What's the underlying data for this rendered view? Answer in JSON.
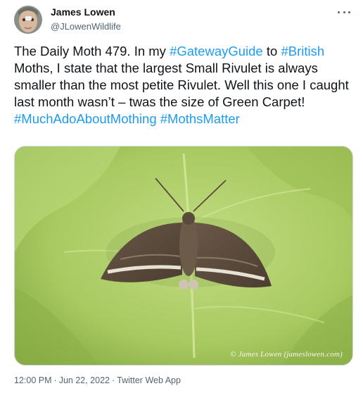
{
  "author": {
    "display_name": "James Lowen",
    "handle": "@JLowenWildlife",
    "avatar_icon": "profile-photo"
  },
  "tweet": {
    "text_parts": [
      {
        "type": "text",
        "value": "The Daily Moth 479. In my "
      },
      {
        "type": "link",
        "value": "#GatewayGuide"
      },
      {
        "type": "text",
        "value": " to "
      },
      {
        "type": "link",
        "value": "#British"
      },
      {
        "type": "text",
        "value": " Moths, I state that the largest Small Rivulet is always smaller than the most petite Rivulet. Well this one I caught last month wasn’t – twas the size of Green Carpet! "
      },
      {
        "type": "link",
        "value": "#MuchAdoAboutMothing"
      },
      {
        "type": "text",
        "value": " "
      },
      {
        "type": "link",
        "value": "#MothsMatter"
      }
    ],
    "image_credit": "© James Lowen (jameslowen.com)",
    "time": "12:00 PM",
    "date": "Jun 22, 2022",
    "source": "Twitter Web App",
    "separator": "·"
  },
  "colors": {
    "link": "#1d9bf0",
    "secondary_text": "#536471",
    "leaf": "#a9c95f"
  }
}
